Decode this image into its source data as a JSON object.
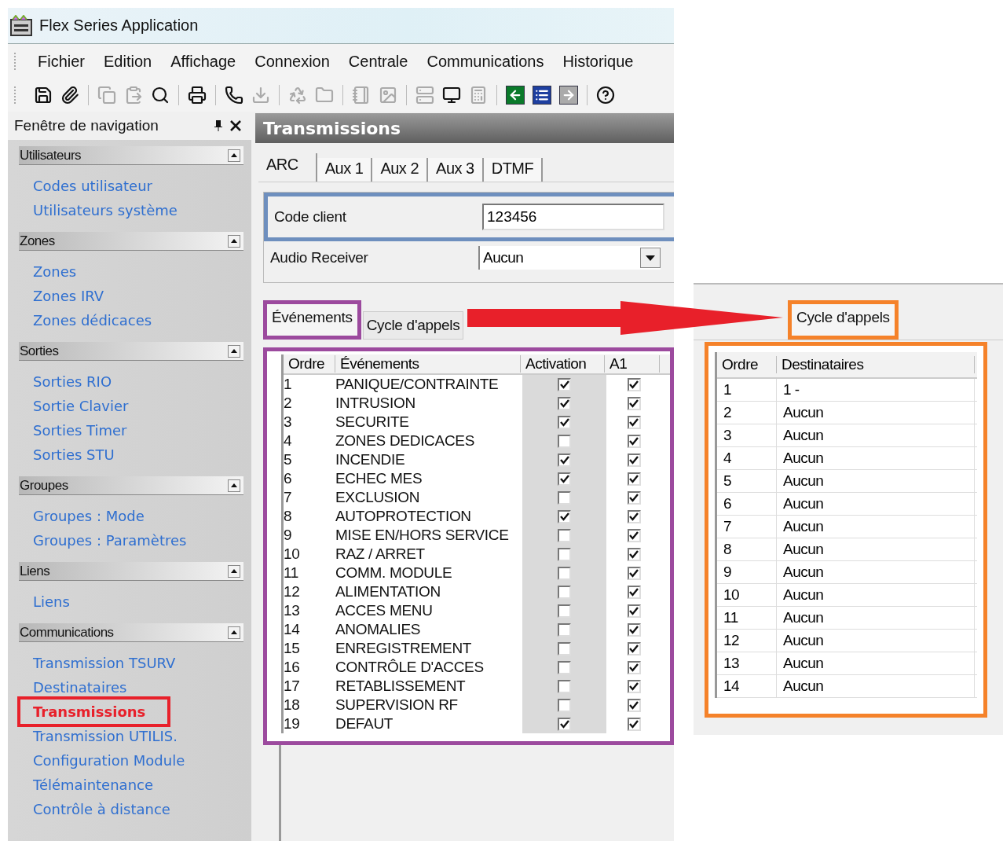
{
  "window": {
    "title": "Flex Series Application"
  },
  "menu": [
    "Fichier",
    "Edition",
    "Affichage",
    "Connexion",
    "Centrale",
    "Communications",
    "Historique"
  ],
  "toolbar": [
    {
      "kind": "save",
      "disabled": false
    },
    {
      "kind": "attach",
      "disabled": false
    },
    {
      "kind": "separator"
    },
    {
      "kind": "copy",
      "disabled": true
    },
    {
      "kind": "paste",
      "disabled": true
    },
    {
      "kind": "search",
      "disabled": false
    },
    {
      "kind": "separator"
    },
    {
      "kind": "print",
      "disabled": false
    },
    {
      "kind": "separator"
    },
    {
      "kind": "phone",
      "disabled": false
    },
    {
      "kind": "download",
      "disabled": true
    },
    {
      "kind": "separator"
    },
    {
      "kind": "recycle",
      "disabled": true
    },
    {
      "kind": "folder",
      "disabled": true
    },
    {
      "kind": "separator"
    },
    {
      "kind": "notebook",
      "disabled": true
    },
    {
      "kind": "image",
      "disabled": true
    },
    {
      "kind": "separator"
    },
    {
      "kind": "server",
      "disabled": true
    },
    {
      "kind": "monitor",
      "disabled": false
    },
    {
      "kind": "calculator",
      "disabled": true
    },
    {
      "kind": "separator"
    },
    {
      "kind": "back",
      "disabled": false
    },
    {
      "kind": "list",
      "disabled": false
    },
    {
      "kind": "forward",
      "disabled": true
    },
    {
      "kind": "separator"
    },
    {
      "kind": "help",
      "disabled": false
    }
  ],
  "navigation": {
    "title": "Fenêtre de navigation",
    "sections": [
      {
        "title": "Utilisateurs",
        "items": [
          {
            "label": "Codes utilisateur",
            "selected": false
          },
          {
            "label": "Utilisateurs système",
            "selected": false
          }
        ]
      },
      {
        "title": "Zones",
        "items": [
          {
            "label": "Zones",
            "selected": false
          },
          {
            "label": "Zones IRV",
            "selected": false
          },
          {
            "label": "Zones dédicaces",
            "selected": false
          }
        ]
      },
      {
        "title": "Sorties",
        "items": [
          {
            "label": "Sorties RIO",
            "selected": false
          },
          {
            "label": "Sortie Clavier",
            "selected": false
          },
          {
            "label": "Sorties Timer",
            "selected": false
          },
          {
            "label": "Sorties STU",
            "selected": false
          }
        ]
      },
      {
        "title": "Groupes",
        "items": [
          {
            "label": "Groupes : Mode",
            "selected": false
          },
          {
            "label": "Groupes : Paramètres",
            "selected": false
          }
        ]
      },
      {
        "title": "Liens",
        "items": [
          {
            "label": "Liens",
            "selected": false
          }
        ]
      },
      {
        "title": "Communications",
        "items": [
          {
            "label": "Transmission TSURV",
            "selected": false
          },
          {
            "label": "Destinataires",
            "selected": false
          },
          {
            "label": "Transmissions",
            "selected": true,
            "color": "#e8202a"
          },
          {
            "label": "Transmission UTILIS.",
            "selected": false
          },
          {
            "label": "Configuration Module",
            "selected": false
          },
          {
            "label": "Télémaintenance",
            "selected": false
          },
          {
            "label": "Contrôle à distance",
            "selected": false
          }
        ]
      }
    ]
  },
  "panel": {
    "title": "Transmissions",
    "tabs": [
      {
        "label": "ARC",
        "selected": true
      },
      {
        "label": "Aux 1",
        "selected": false
      },
      {
        "label": "Aux 2",
        "selected": false
      },
      {
        "label": "Aux 3",
        "selected": false
      },
      {
        "label": "DTMF",
        "selected": false
      }
    ],
    "code_client": {
      "label": "Code client",
      "value": "123456",
      "color": "#6e8fbe"
    },
    "audio_receiver": {
      "label": "Audio Receiver",
      "value": "Aucun"
    },
    "subtabs": [
      {
        "label": "Événements",
        "selected": true,
        "color": "#9c4a9e"
      },
      {
        "label": "Cycle d'appels",
        "selected": false
      }
    ],
    "events_table": {
      "color": "#9c4a9e",
      "columns": [
        "Ordre",
        "Événements",
        "Activation",
        "A1"
      ],
      "rows": [
        {
          "order": "1",
          "event": "PANIQUE/CONTRAINTE",
          "activation": true,
          "a1": true
        },
        {
          "order": "2",
          "event": "INTRUSION",
          "activation": true,
          "a1": true
        },
        {
          "order": "3",
          "event": "SECURITE",
          "activation": true,
          "a1": true
        },
        {
          "order": "4",
          "event": "ZONES DEDICACES",
          "activation": false,
          "a1": true
        },
        {
          "order": "5",
          "event": "INCENDIE",
          "activation": true,
          "a1": true
        },
        {
          "order": "6",
          "event": "ECHEC MES",
          "activation": true,
          "a1": true
        },
        {
          "order": "7",
          "event": "EXCLUSION",
          "activation": false,
          "a1": true
        },
        {
          "order": "8",
          "event": "AUTOPROTECTION",
          "activation": true,
          "a1": true
        },
        {
          "order": "9",
          "event": "MISE EN/HORS SERVICE",
          "activation": false,
          "a1": true
        },
        {
          "order": "10",
          "event": "RAZ / ARRET",
          "activation": false,
          "a1": true
        },
        {
          "order": "11",
          "event": "COMM. MODULE",
          "activation": false,
          "a1": true
        },
        {
          "order": "12",
          "event": "ALIMENTATION",
          "activation": false,
          "a1": true
        },
        {
          "order": "13",
          "event": "ACCES MENU",
          "activation": false,
          "a1": true
        },
        {
          "order": "14",
          "event": "ANOMALIES",
          "activation": false,
          "a1": true
        },
        {
          "order": "15",
          "event": "ENREGISTREMENT",
          "activation": false,
          "a1": true
        },
        {
          "order": "16",
          "event": "CONTRÔLE D'ACCES",
          "activation": false,
          "a1": true
        },
        {
          "order": "17",
          "event": "RETABLISSEMENT",
          "activation": false,
          "a1": true
        },
        {
          "order": "18",
          "event": "SUPERVISION RF",
          "activation": false,
          "a1": true
        },
        {
          "order": "19",
          "event": "DEFAUT",
          "activation": true,
          "a1": true
        }
      ]
    }
  },
  "inset": {
    "tab": {
      "label": "Cycle d'appels",
      "selected": true,
      "color": "#f5822a"
    },
    "table": {
      "color": "#f5822a",
      "columns": [
        "Ordre",
        "Destinataires"
      ],
      "rows": [
        {
          "order": "1",
          "recipient": "1 -"
        },
        {
          "order": "2",
          "recipient": "Aucun"
        },
        {
          "order": "3",
          "recipient": "Aucun"
        },
        {
          "order": "4",
          "recipient": "Aucun"
        },
        {
          "order": "5",
          "recipient": "Aucun"
        },
        {
          "order": "6",
          "recipient": "Aucun"
        },
        {
          "order": "7",
          "recipient": "Aucun"
        },
        {
          "order": "8",
          "recipient": "Aucun"
        },
        {
          "order": "9",
          "recipient": "Aucun"
        },
        {
          "order": "10",
          "recipient": "Aucun"
        },
        {
          "order": "11",
          "recipient": "Aucun"
        },
        {
          "order": "12",
          "recipient": "Aucun"
        },
        {
          "order": "13",
          "recipient": "Aucun"
        },
        {
          "order": "14",
          "recipient": "Aucun"
        }
      ]
    }
  }
}
